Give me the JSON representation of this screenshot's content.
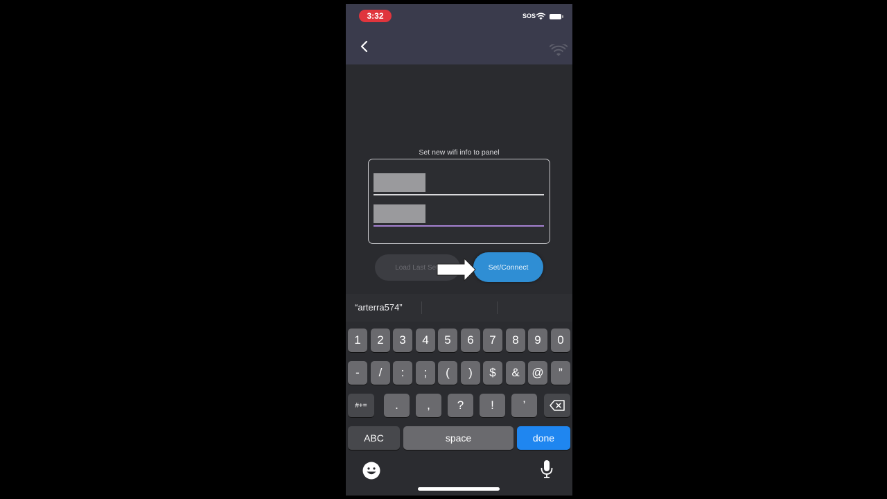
{
  "status": {
    "time": "3:32",
    "carrier": "SOS"
  },
  "panel": {
    "label": "Set new wifi info to panel",
    "ssid_value": "",
    "password_value": ""
  },
  "buttons": {
    "load_last": "Load Last Sett",
    "connect": "Set/Connect"
  },
  "suggestion": {
    "text": "“arterra574”"
  },
  "keyboard": {
    "row1": [
      "1",
      "2",
      "3",
      "4",
      "5",
      "6",
      "7",
      "8",
      "9",
      "0"
    ],
    "row2": [
      "-",
      "/",
      ":",
      ";",
      "(",
      ")",
      "$",
      "&",
      "@",
      "”"
    ],
    "symbols_toggle": "#+=",
    "row3": [
      ".",
      ",",
      "?",
      "!",
      "’"
    ],
    "abc": "ABC",
    "space": "space",
    "done": "done"
  },
  "colors": {
    "accent": "#2f8ed4",
    "done_key": "#1f86f0",
    "time_pill": "#e0353d",
    "active_underline": "#a682d2"
  }
}
